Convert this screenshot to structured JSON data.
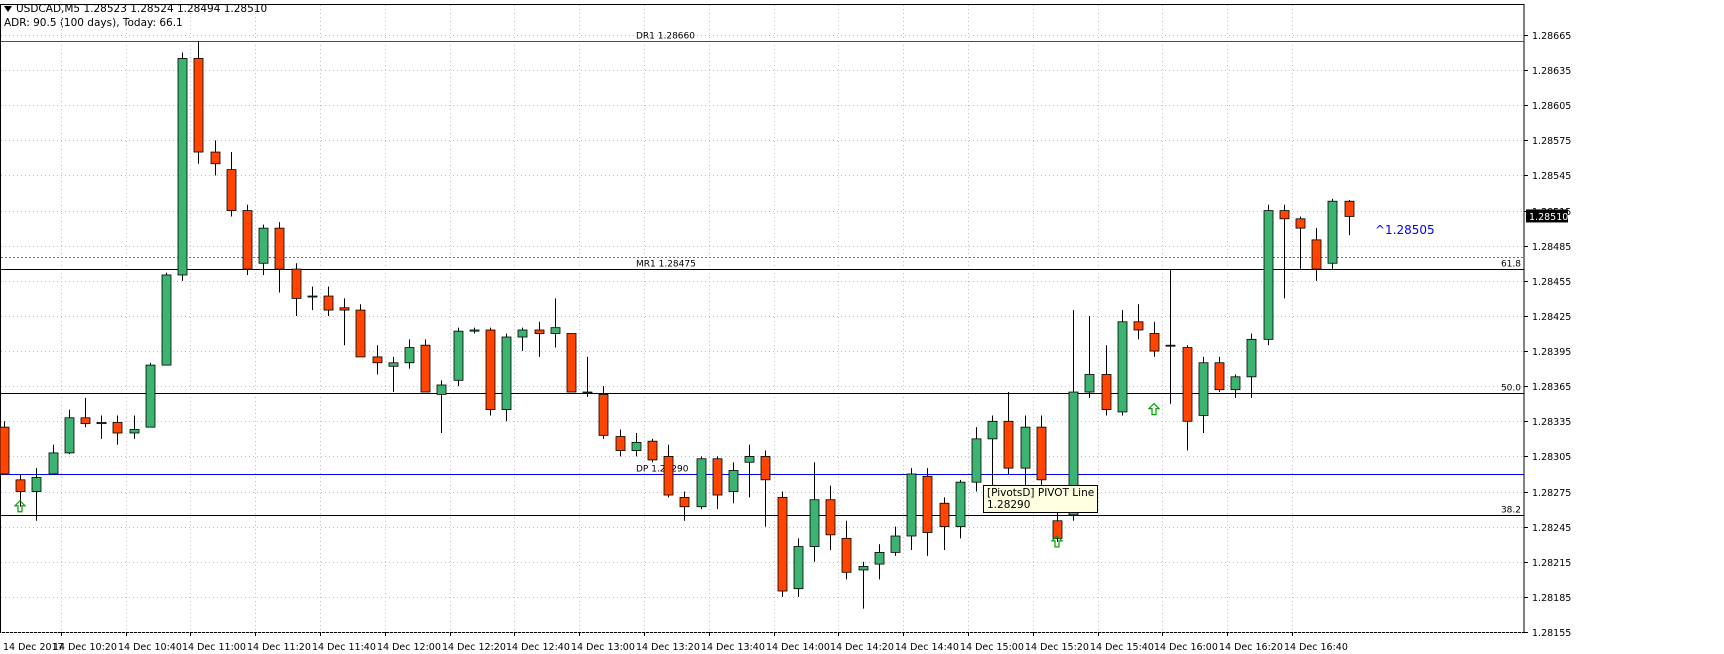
{
  "header": {
    "symbol_line": "USDCAD,M5  1.28523 1.28524 1.28494 1.28510",
    "adr_line": "ADR: 90.5 (100 days), Today: 66.1"
  },
  "colors": {
    "background": "#ffffff",
    "grid": "#c0c0c0",
    "bull_body": "#3cb371",
    "bear_body": "#ff4500",
    "wick": "#000000",
    "dr1_line": "#ff0000",
    "pivot_line": "#0000ff",
    "fib_line": "#000000",
    "dotted_level": "#808000",
    "price_label": "#0000ff",
    "arrow": "#00a000",
    "tooltip_bg": "#ffffe1"
  },
  "tooltip": {
    "line1": "[PivotsD] PIVOT Line",
    "line2": "1.28290"
  },
  "chart_data": {
    "type": "candlestick",
    "symbol": "USDCAD",
    "timeframe": "M5",
    "ylim": [
      1.2814,
      1.2868
    ],
    "y_ticks": [
      "1.28665",
      "1.28635",
      "1.28605",
      "1.28575",
      "1.28545",
      "1.28515",
      "1.28485",
      "1.28455",
      "1.28425",
      "1.28395",
      "1.28365",
      "1.28335",
      "1.28305",
      "1.28275",
      "1.28245",
      "1.28215",
      "1.28185",
      "1.28155"
    ],
    "x_labels": [
      "14 Dec 2017",
      "14 Dec 10:20",
      "14 Dec 10:40",
      "14 Dec 11:00",
      "14 Dec 11:20",
      "14 Dec 11:40",
      "14 Dec 12:00",
      "14 Dec 12:20",
      "14 Dec 12:40",
      "14 Dec 13:00",
      "14 Dec 13:20",
      "14 Dec 13:40",
      "14 Dec 14:00",
      "14 Dec 14:20",
      "14 Dec 14:40",
      "14 Dec 15:00",
      "14 Dec 15:20",
      "14 Dec 15:40",
      "14 Dec 16:00",
      "14 Dec 16:20",
      "14 Dec 16:40"
    ],
    "current_price_label": "1.28510",
    "floating_label": "^1.28505",
    "levels": [
      {
        "name": "DR1",
        "text": "DR1   1.28660",
        "value": 1.2866,
        "color": "#ff0000",
        "style": "solid"
      },
      {
        "name": "MR1",
        "text": "MR1   1.28475",
        "value": 1.28465,
        "color": "#000000",
        "style": "solid"
      },
      {
        "name": "dotted",
        "text": "",
        "value": 1.28475,
        "color": "#808000",
        "style": "dotted"
      },
      {
        "name": "PIVOT",
        "text": "DP   1.28290",
        "value": 1.2829,
        "color": "#0000ff",
        "style": "solid"
      },
      {
        "name": "fib50",
        "text": "50.0",
        "value": 1.28359,
        "color": "#000000",
        "style": "solid"
      },
      {
        "name": "fib382",
        "text": "38.2",
        "value": 1.28255,
        "color": "#000000",
        "style": "solid"
      },
      {
        "name": "fib618",
        "text": "61.8",
        "value": 1.28465,
        "color": "#000000",
        "style": "solid"
      }
    ],
    "arrows": [
      {
        "candle": 1,
        "price": 1.28262
      },
      {
        "candle": 65,
        "price": 1.28232
      },
      {
        "candle": 71,
        "price": 1.28345
      }
    ],
    "candles": [
      {
        "o": 1.2833,
        "h": 1.28335,
        "l": 1.2829,
        "c": 1.2829
      },
      {
        "o": 1.28285,
        "h": 1.2829,
        "l": 1.28262,
        "c": 1.28275
      },
      {
        "o": 1.28275,
        "h": 1.28295,
        "l": 1.2825,
        "c": 1.28287
      },
      {
        "o": 1.2829,
        "h": 1.28315,
        "l": 1.2829,
        "c": 1.28308
      },
      {
        "o": 1.28308,
        "h": 1.28345,
        "l": 1.28307,
        "c": 1.28338
      },
      {
        "o": 1.28338,
        "h": 1.28355,
        "l": 1.2833,
        "c": 1.28333
      },
      {
        "o": 1.28333,
        "h": 1.2834,
        "l": 1.2832,
        "c": 1.28334
      },
      {
        "o": 1.28334,
        "h": 1.2834,
        "l": 1.28315,
        "c": 1.28325
      },
      {
        "o": 1.28325,
        "h": 1.2834,
        "l": 1.2832,
        "c": 1.28328
      },
      {
        "o": 1.2833,
        "h": 1.28385,
        "l": 1.2833,
        "c": 1.28383
      },
      {
        "o": 1.28383,
        "h": 1.28462,
        "l": 1.28383,
        "c": 1.2846
      },
      {
        "o": 1.2846,
        "h": 1.2865,
        "l": 1.28455,
        "c": 1.28645
      },
      {
        "o": 1.28645,
        "h": 1.2866,
        "l": 1.28555,
        "c": 1.28565
      },
      {
        "o": 1.28565,
        "h": 1.28575,
        "l": 1.28545,
        "c": 1.28555
      },
      {
        "o": 1.2855,
        "h": 1.28565,
        "l": 1.2851,
        "c": 1.28515
      },
      {
        "o": 1.28515,
        "h": 1.2852,
        "l": 1.2846,
        "c": 1.28465
      },
      {
        "o": 1.2847,
        "h": 1.28503,
        "l": 1.2846,
        "c": 1.285
      },
      {
        "o": 1.285,
        "h": 1.28505,
        "l": 1.28445,
        "c": 1.28465
      },
      {
        "o": 1.28465,
        "h": 1.2847,
        "l": 1.28425,
        "c": 1.2844
      },
      {
        "o": 1.28442,
        "h": 1.2845,
        "l": 1.2843,
        "c": 1.28442
      },
      {
        "o": 1.28442,
        "h": 1.2845,
        "l": 1.28425,
        "c": 1.2843
      },
      {
        "o": 1.28432,
        "h": 1.2844,
        "l": 1.284,
        "c": 1.2843
      },
      {
        "o": 1.2843,
        "h": 1.28435,
        "l": 1.2839,
        "c": 1.2839
      },
      {
        "o": 1.2839,
        "h": 1.284,
        "l": 1.28375,
        "c": 1.28385
      },
      {
        "o": 1.28382,
        "h": 1.2839,
        "l": 1.2836,
        "c": 1.28385
      },
      {
        "o": 1.28385,
        "h": 1.28405,
        "l": 1.2838,
        "c": 1.28398
      },
      {
        "o": 1.284,
        "h": 1.28405,
        "l": 1.2836,
        "c": 1.2836
      },
      {
        "o": 1.28358,
        "h": 1.2837,
        "l": 1.28325,
        "c": 1.28366
      },
      {
        "o": 1.2837,
        "h": 1.28415,
        "l": 1.28365,
        "c": 1.28412
      },
      {
        "o": 1.28412,
        "h": 1.28415,
        "l": 1.2841,
        "c": 1.28413
      },
      {
        "o": 1.28413,
        "h": 1.28415,
        "l": 1.2834,
        "c": 1.28345
      },
      {
        "o": 1.28345,
        "h": 1.2841,
        "l": 1.28335,
        "c": 1.28407
      },
      {
        "o": 1.28407,
        "h": 1.28415,
        "l": 1.28395,
        "c": 1.28413
      },
      {
        "o": 1.28413,
        "h": 1.2842,
        "l": 1.2839,
        "c": 1.2841
      },
      {
        "o": 1.2841,
        "h": 1.2844,
        "l": 1.28398,
        "c": 1.28415
      },
      {
        "o": 1.2841,
        "h": 1.2841,
        "l": 1.2836,
        "c": 1.2836
      },
      {
        "o": 1.2836,
        "h": 1.2839,
        "l": 1.28356,
        "c": 1.2836
      },
      {
        "o": 1.28358,
        "h": 1.28365,
        "l": 1.2832,
        "c": 1.28323
      },
      {
        "o": 1.28322,
        "h": 1.28328,
        "l": 1.28305,
        "c": 1.2831
      },
      {
        "o": 1.2831,
        "h": 1.28325,
        "l": 1.28305,
        "c": 1.28317
      },
      {
        "o": 1.28318,
        "h": 1.2832,
        "l": 1.283,
        "c": 1.28302
      },
      {
        "o": 1.28305,
        "h": 1.28315,
        "l": 1.2827,
        "c": 1.28272
      },
      {
        "o": 1.2827,
        "h": 1.28275,
        "l": 1.2825,
        "c": 1.28262
      },
      {
        "o": 1.28262,
        "h": 1.28305,
        "l": 1.2826,
        "c": 1.28303
      },
      {
        "o": 1.28303,
        "h": 1.28305,
        "l": 1.2826,
        "c": 1.28272
      },
      {
        "o": 1.28275,
        "h": 1.283,
        "l": 1.28265,
        "c": 1.28293
      },
      {
        "o": 1.283,
        "h": 1.28315,
        "l": 1.2827,
        "c": 1.28305
      },
      {
        "o": 1.28305,
        "h": 1.2831,
        "l": 1.28245,
        "c": 1.28285
      },
      {
        "o": 1.2827,
        "h": 1.28275,
        "l": 1.28185,
        "c": 1.2819
      },
      {
        "o": 1.28192,
        "h": 1.28235,
        "l": 1.28185,
        "c": 1.28228
      },
      {
        "o": 1.28228,
        "h": 1.283,
        "l": 1.28215,
        "c": 1.28268
      },
      {
        "o": 1.28268,
        "h": 1.2828,
        "l": 1.28225,
        "c": 1.28238
      },
      {
        "o": 1.28235,
        "h": 1.2825,
        "l": 1.282,
        "c": 1.28206
      },
      {
        "o": 1.28208,
        "h": 1.28215,
        "l": 1.28175,
        "c": 1.28211
      },
      {
        "o": 1.28213,
        "h": 1.2823,
        "l": 1.282,
        "c": 1.28223
      },
      {
        "o": 1.28223,
        "h": 1.28245,
        "l": 1.2822,
        "c": 1.28237
      },
      {
        "o": 1.28237,
        "h": 1.28295,
        "l": 1.28225,
        "c": 1.2829
      },
      {
        "o": 1.28288,
        "h": 1.28295,
        "l": 1.2822,
        "c": 1.2824
      },
      {
        "o": 1.28265,
        "h": 1.2827,
        "l": 1.28225,
        "c": 1.28245
      },
      {
        "o": 1.28245,
        "h": 1.28285,
        "l": 1.28235,
        "c": 1.28283
      },
      {
        "o": 1.28283,
        "h": 1.2833,
        "l": 1.28275,
        "c": 1.2832
      },
      {
        "o": 1.2832,
        "h": 1.2834,
        "l": 1.28265,
        "c": 1.28335
      },
      {
        "o": 1.28335,
        "h": 1.2836,
        "l": 1.2829,
        "c": 1.28295
      },
      {
        "o": 1.28295,
        "h": 1.2834,
        "l": 1.2826,
        "c": 1.2833
      },
      {
        "o": 1.2833,
        "h": 1.2834,
        "l": 1.2828,
        "c": 1.28285
      },
      {
        "o": 1.2825,
        "h": 1.2826,
        "l": 1.28232,
        "c": 1.28235
      },
      {
        "o": 1.28255,
        "h": 1.2843,
        "l": 1.2825,
        "c": 1.2836
      },
      {
        "o": 1.2836,
        "h": 1.28425,
        "l": 1.28355,
        "c": 1.28375
      },
      {
        "o": 1.28375,
        "h": 1.284,
        "l": 1.2834,
        "c": 1.28345
      },
      {
        "o": 1.28343,
        "h": 1.2843,
        "l": 1.2834,
        "c": 1.2842
      },
      {
        "o": 1.2842,
        "h": 1.28435,
        "l": 1.28405,
        "c": 1.28413
      },
      {
        "o": 1.2841,
        "h": 1.2842,
        "l": 1.2839,
        "c": 1.28395
      },
      {
        "o": 1.284,
        "h": 1.28465,
        "l": 1.2835,
        "c": 1.284
      },
      {
        "o": 1.28398,
        "h": 1.284,
        "l": 1.2831,
        "c": 1.28335
      },
      {
        "o": 1.2834,
        "h": 1.2839,
        "l": 1.28325,
        "c": 1.28385
      },
      {
        "o": 1.28385,
        "h": 1.2839,
        "l": 1.2836,
        "c": 1.28362
      },
      {
        "o": 1.28362,
        "h": 1.28375,
        "l": 1.28355,
        "c": 1.28373
      },
      {
        "o": 1.28373,
        "h": 1.2841,
        "l": 1.28355,
        "c": 1.28405
      },
      {
        "o": 1.28405,
        "h": 1.2852,
        "l": 1.284,
        "c": 1.28515
      },
      {
        "o": 1.28515,
        "h": 1.2852,
        "l": 1.2844,
        "c": 1.28508
      },
      {
        "o": 1.28508,
        "h": 1.2851,
        "l": 1.28465,
        "c": 1.285
      },
      {
        "o": 1.2849,
        "h": 1.285,
        "l": 1.28455,
        "c": 1.28465
      },
      {
        "o": 1.2847,
        "h": 1.28525,
        "l": 1.28465,
        "c": 1.28523
      },
      {
        "o": 1.28523,
        "h": 1.28524,
        "l": 1.28494,
        "c": 1.2851
      }
    ]
  }
}
